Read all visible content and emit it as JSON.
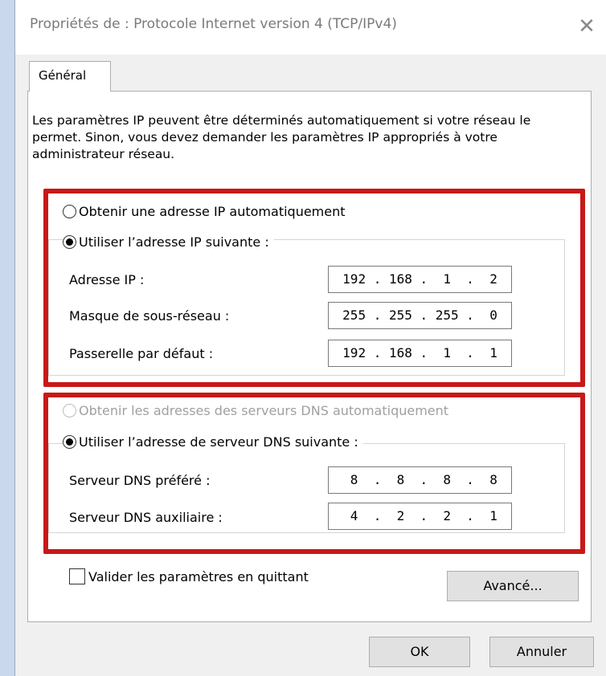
{
  "window": {
    "title": "Propriétés de : Protocole Internet version 4 (TCP/IPv4)",
    "close_glyph": "✕"
  },
  "tabs": [
    {
      "label": "Général"
    }
  ],
  "intro_text": "Les paramètres IP peuvent être déterminés automatiquement si votre réseau le permet. Sinon, vous devez demander les paramètres IP appropriés à votre administrateur réseau.",
  "ip_section": {
    "auto_label": "Obtenir une adresse IP automatiquement",
    "manual_label": "Utiliser l’adresse IP suivante :",
    "selected": "manual",
    "fields": [
      {
        "label": "Adresse IP :",
        "value": "192 . 168 .  1  .  2"
      },
      {
        "label": "Masque de sous-réseau :",
        "value": "255 . 255 . 255 .  0"
      },
      {
        "label": "Passerelle par défaut :",
        "value": "192 . 168 .  1  .  1"
      }
    ]
  },
  "dns_section": {
    "auto_label": "Obtenir les adresses des serveurs DNS automatiquement",
    "auto_disabled": true,
    "manual_label": "Utiliser l’adresse de serveur DNS suivante :",
    "selected": "manual",
    "fields": [
      {
        "label": "Serveur DNS préféré :",
        "value": " 8  .  8  .  8  .  8"
      },
      {
        "label": "Serveur DNS auxiliaire :",
        "value": " 4  .  2  .  2  .  1"
      }
    ]
  },
  "validate_checkbox": {
    "label": "Valider les paramètres en quittant",
    "checked": false
  },
  "buttons": {
    "advanced": "Avancé...",
    "ok": "OK",
    "cancel": "Annuler"
  },
  "colors": {
    "highlight_border": "#c81818",
    "background": "#c9d8ec",
    "dialog": "#f0f0f0"
  }
}
